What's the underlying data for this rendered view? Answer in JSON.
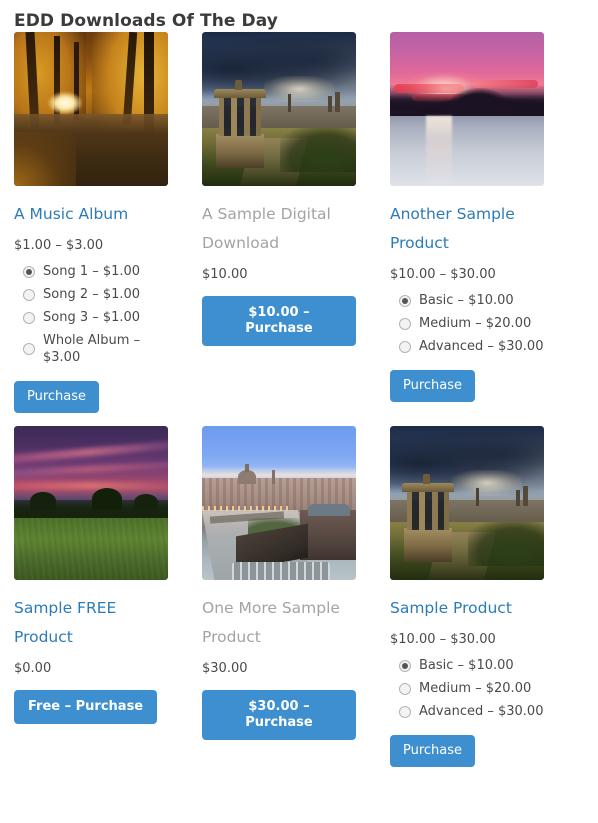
{
  "header": {
    "title": "EDD Downloads Of The Day"
  },
  "colors": {
    "link": "#2b7bb9",
    "link_muted": "#a3a3a3",
    "button_bg": "#3e8fd0",
    "button_text": "#ffffff",
    "text": "#4a4a4a",
    "heading": "#3b3b3b"
  },
  "products": [
    {
      "title": "A Music Album",
      "title_state": "normal",
      "image_name": "autumn-forest-path-photo",
      "price": "$1.00 – $3.00",
      "options": [
        {
          "label": "Song 1 – $1.00",
          "checked": true
        },
        {
          "label": "Song 2 – $1.00",
          "checked": false
        },
        {
          "label": "Song 3 – $1.00",
          "checked": false
        },
        {
          "label": "Whole Album – $3.00",
          "checked": false
        }
      ],
      "button_label": "Purchase",
      "button_bold": false
    },
    {
      "title": "A Sample Digital Download",
      "title_state": "muted",
      "image_name": "edinburgh-calton-hill-photo",
      "price": "$10.00",
      "options": [],
      "button_label": "$10.00 – Purchase",
      "button_bold": true
    },
    {
      "title": "Another Sample Product",
      "title_state": "normal",
      "image_name": "pink-sunset-sea-photo",
      "price": "$10.00 – $30.00",
      "options": [
        {
          "label": "Basic – $10.00",
          "checked": true
        },
        {
          "label": "Medium – $20.00",
          "checked": false
        },
        {
          "label": "Advanced – $30.00",
          "checked": false
        }
      ],
      "button_label": "Purchase",
      "button_bold": false
    },
    {
      "title": "Sample FREE Product",
      "title_state": "normal",
      "image_name": "meadow-purple-sunset-photo",
      "price": "$0.00",
      "options": [],
      "button_label": "Free – Purchase",
      "button_bold": true
    },
    {
      "title": "One More Sample Product",
      "title_state": "muted",
      "image_name": "paris-skyline-river-photo",
      "price": "$30.00",
      "options": [],
      "button_label": "$30.00 – Purchase",
      "button_bold": true
    },
    {
      "title": "Sample Product",
      "title_state": "normal",
      "image_name": "edinburgh-calton-hill-photo",
      "price": "$10.00 – $30.00",
      "options": [
        {
          "label": "Basic – $10.00",
          "checked": true
        },
        {
          "label": "Medium – $20.00",
          "checked": false
        },
        {
          "label": "Advanced – $30.00",
          "checked": false
        }
      ],
      "button_label": "Purchase",
      "button_bold": false
    }
  ]
}
